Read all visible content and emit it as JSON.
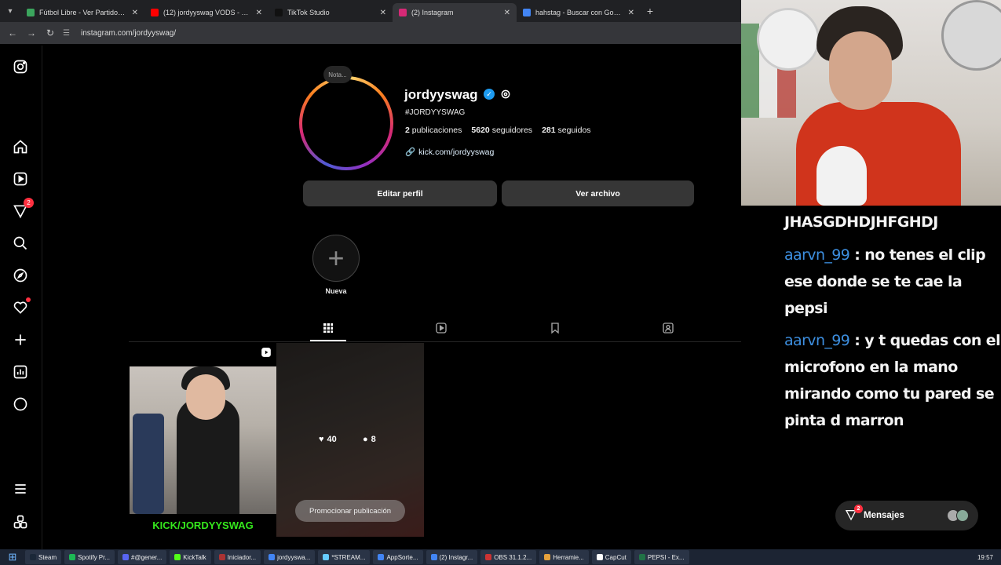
{
  "browser": {
    "tabs": [
      {
        "title": "Fútbol Libre - Ver Partidos de F",
        "color": "#3ba55d",
        "active": false
      },
      {
        "title": "(12) jordyyswag VODS - YouTub",
        "color": "#ff0000",
        "active": false
      },
      {
        "title": "TikTok Studio",
        "color": "#111111",
        "active": false
      },
      {
        "title": "(2) Instagram",
        "color": "#d62976",
        "active": true
      },
      {
        "title": "hahstag - Buscar con Google",
        "color": "#4285f4",
        "active": false
      }
    ],
    "url": "instagram.com/jordyyswag/"
  },
  "sidebar": {
    "notifications_badge": "2"
  },
  "profile": {
    "note": "Nota...",
    "username": "jordyyswag",
    "full_name": "#JORDYYSWAG",
    "posts_count": "2",
    "posts_label": "publicaciones",
    "followers_count": "5620",
    "followers_label": "seguidores",
    "following_count": "281",
    "following_label": "seguidos",
    "link": "kick.com/jordyyswag",
    "edit_button": "Editar perfil",
    "archive_button": "Ver archivo",
    "highlight_new_label": "Nueva"
  },
  "posts": [
    {
      "caption": "KICK/JORDYYSWAG"
    },
    {
      "likes": "40",
      "comments": "8",
      "promote_label": "Promocionar publicación"
    }
  ],
  "chat": {
    "messages": [
      {
        "user": "",
        "text": "JHASGDHDJHFGHDJ"
      },
      {
        "user": "aarvn_99",
        "text": ": no tenes el clip ese donde se te cae la pepsi"
      },
      {
        "user": "aarvn_99",
        "text": ": y t quedas con el microfono en la mano mirando como tu pared se pinta d marron"
      }
    ]
  },
  "messages_bubble": {
    "label": "Mensajes",
    "badge": "2"
  },
  "taskbar": {
    "items": [
      "Steam",
      "Spotify Pr...",
      "#@gener...",
      "KickTalk",
      "Iniciador...",
      "jordyyswa...",
      "*STREAM...",
      "AppSorte...",
      "(2) Instagr...",
      "OBS 31.1.2...",
      "Herramie...",
      "CapCut",
      "PEPSI - Ex..."
    ],
    "clock": "19:57"
  }
}
